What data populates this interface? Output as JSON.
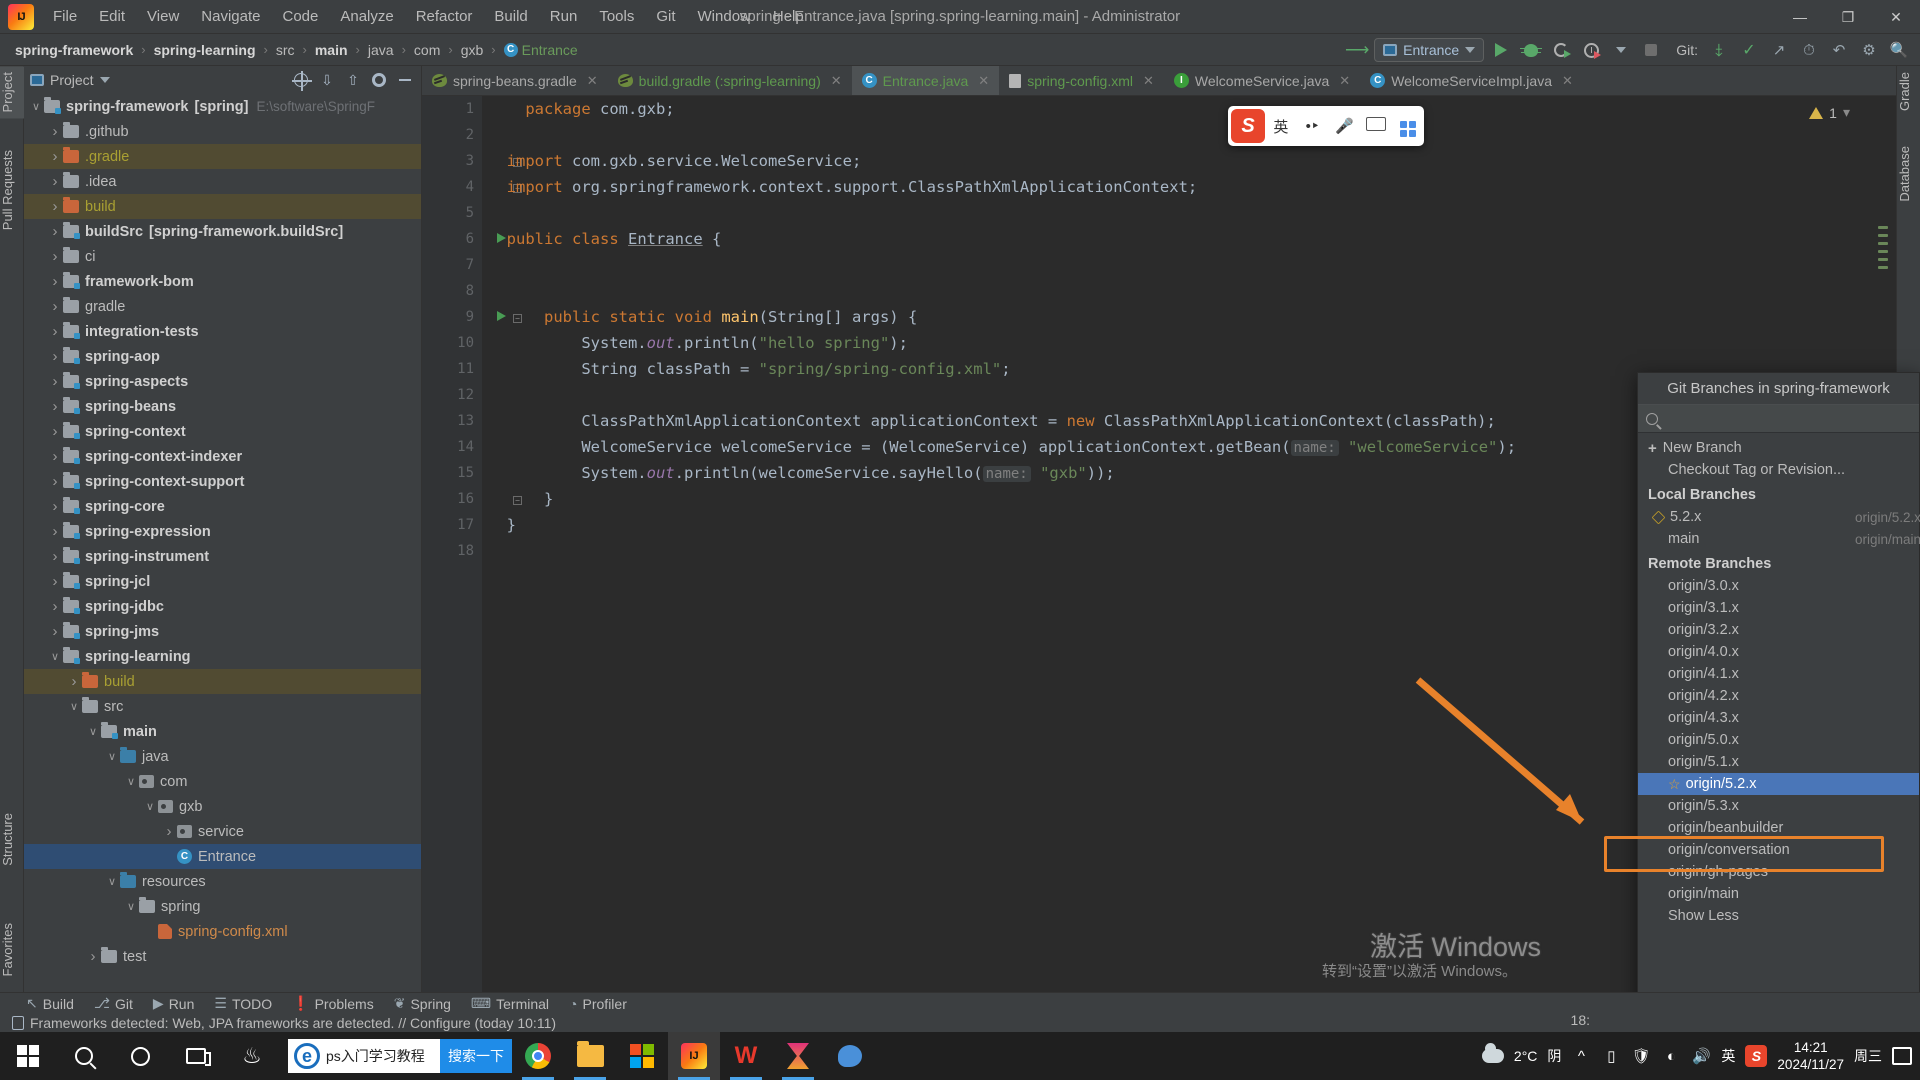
{
  "window": {
    "title": "spring - Entrance.java [spring.spring-learning.main] - Administrator",
    "minimize": "—",
    "maximize": "❐",
    "close": "✕"
  },
  "menu": {
    "items": [
      "File",
      "Edit",
      "View",
      "Navigate",
      "Code",
      "Analyze",
      "Refactor",
      "Build",
      "Run",
      "Tools",
      "Git",
      "Window",
      "Help"
    ]
  },
  "breadcrumb": {
    "items": [
      "spring-framework",
      "spring-learning",
      "src",
      "main",
      "java",
      "com",
      "gxb",
      "Entrance"
    ]
  },
  "toolbar": {
    "run_config": "Entrance",
    "git_label": "Git:",
    "icons": [
      "update-project-icon",
      "run-icon",
      "debug-icon",
      "run-coverage-icon",
      "profiler-icon",
      "stop-icon",
      "commit-icon",
      "update-icon",
      "push-icon",
      "history-icon",
      "rollback-icon",
      "settings-icon",
      "search-everywhere-icon"
    ]
  },
  "project_panel": {
    "title": "Project",
    "header_icons": [
      "locate-icon",
      "expand-all-icon",
      "collapse-all-icon",
      "gear-icon",
      "hide-icon"
    ],
    "tree": [
      {
        "depth": 0,
        "chev": "open",
        "icon": "module-folder",
        "label": "spring-framework",
        "suffix": "[spring]",
        "path": "E:\\software\\SpringF",
        "style": "bold"
      },
      {
        "depth": 1,
        "chev": "closed",
        "icon": "folder",
        "label": ".github"
      },
      {
        "depth": 1,
        "chev": "closed",
        "icon": "folder-orange",
        "label": ".gradle",
        "style": "excluded",
        "highlight": "build"
      },
      {
        "depth": 1,
        "chev": "closed",
        "icon": "folder",
        "label": ".idea"
      },
      {
        "depth": 1,
        "chev": "closed",
        "icon": "folder-orange",
        "label": "build",
        "style": "excluded",
        "highlight": "build"
      },
      {
        "depth": 1,
        "chev": "closed",
        "icon": "module-folder",
        "label": "buildSrc",
        "suffix": "[spring-framework.buildSrc]",
        "style": "bold"
      },
      {
        "depth": 1,
        "chev": "closed",
        "icon": "folder",
        "label": "ci"
      },
      {
        "depth": 1,
        "chev": "closed",
        "icon": "module-folder",
        "label": "framework-bom",
        "style": "bold"
      },
      {
        "depth": 1,
        "chev": "closed",
        "icon": "folder",
        "label": "gradle"
      },
      {
        "depth": 1,
        "chev": "closed",
        "icon": "module-folder",
        "label": "integration-tests",
        "style": "bold"
      },
      {
        "depth": 1,
        "chev": "closed",
        "icon": "module-folder",
        "label": "spring-aop",
        "style": "bold"
      },
      {
        "depth": 1,
        "chev": "closed",
        "icon": "module-folder",
        "label": "spring-aspects",
        "style": "bold"
      },
      {
        "depth": 1,
        "chev": "closed",
        "icon": "module-folder",
        "label": "spring-beans",
        "style": "bold"
      },
      {
        "depth": 1,
        "chev": "closed",
        "icon": "module-folder",
        "label": "spring-context",
        "style": "bold"
      },
      {
        "depth": 1,
        "chev": "closed",
        "icon": "module-folder",
        "label": "spring-context-indexer",
        "style": "bold"
      },
      {
        "depth": 1,
        "chev": "closed",
        "icon": "module-folder",
        "label": "spring-context-support",
        "style": "bold"
      },
      {
        "depth": 1,
        "chev": "closed",
        "icon": "module-folder",
        "label": "spring-core",
        "style": "bold"
      },
      {
        "depth": 1,
        "chev": "closed",
        "icon": "module-folder",
        "label": "spring-expression",
        "style": "bold"
      },
      {
        "depth": 1,
        "chev": "closed",
        "icon": "module-folder",
        "label": "spring-instrument",
        "style": "bold"
      },
      {
        "depth": 1,
        "chev": "closed",
        "icon": "module-folder",
        "label": "spring-jcl",
        "style": "bold"
      },
      {
        "depth": 1,
        "chev": "closed",
        "icon": "module-folder",
        "label": "spring-jdbc",
        "style": "bold"
      },
      {
        "depth": 1,
        "chev": "closed",
        "icon": "module-folder",
        "label": "spring-jms",
        "style": "bold"
      },
      {
        "depth": 1,
        "chev": "open",
        "icon": "module-folder",
        "label": "spring-learning",
        "style": "bold"
      },
      {
        "depth": 2,
        "chev": "closed",
        "icon": "folder-orange",
        "label": "build",
        "style": "excluded",
        "highlight": "build"
      },
      {
        "depth": 2,
        "chev": "open",
        "icon": "folder",
        "label": "src"
      },
      {
        "depth": 3,
        "chev": "open",
        "icon": "module-folder",
        "label": "main",
        "style": "bold"
      },
      {
        "depth": 4,
        "chev": "open",
        "icon": "folder-blue",
        "label": "java"
      },
      {
        "depth": 5,
        "chev": "open",
        "icon": "package",
        "label": "com"
      },
      {
        "depth": 6,
        "chev": "open",
        "icon": "package",
        "label": "gxb"
      },
      {
        "depth": 7,
        "chev": "closed",
        "icon": "package",
        "label": "service"
      },
      {
        "depth": 7,
        "chev": "none",
        "icon": "class",
        "label": "Entrance",
        "selected": true
      },
      {
        "depth": 4,
        "chev": "open",
        "icon": "folder-blue",
        "label": "resources"
      },
      {
        "depth": 5,
        "chev": "open",
        "icon": "folder",
        "label": "spring"
      },
      {
        "depth": 6,
        "chev": "none",
        "icon": "xml",
        "label": "spring-config.xml",
        "style": "xml"
      },
      {
        "depth": 3,
        "chev": "closed",
        "icon": "folder",
        "label": "test"
      }
    ]
  },
  "left_stripe": {
    "tabs": [
      "Project",
      "Pull Requests",
      "Structure",
      "Favorites"
    ]
  },
  "right_stripe": {
    "tabs": [
      "Gradle",
      "Database"
    ]
  },
  "editor": {
    "tabs": [
      {
        "label": "spring-beans.gradle",
        "icon": "gradle-icon",
        "active": false,
        "color": "normal"
      },
      {
        "label": "build.gradle (:spring-learning)",
        "icon": "gradle-icon",
        "active": false,
        "color": "green"
      },
      {
        "label": "Entrance.java",
        "icon": "class-icon",
        "active": true,
        "color": "green"
      },
      {
        "label": "spring-config.xml",
        "icon": "xml-icon",
        "active": false,
        "color": "green"
      },
      {
        "label": "WelcomeService.java",
        "icon": "interface-icon",
        "active": false,
        "color": "normal"
      },
      {
        "label": "WelcomeServiceImpl.java",
        "icon": "class-icon",
        "active": false,
        "color": "normal"
      }
    ],
    "warning_count": "1",
    "lines": [
      {
        "n": "1",
        "html": "    <span class='kw'>package</span> com.gxb;"
      },
      {
        "n": "2",
        "html": ""
      },
      {
        "n": "3",
        "html": "  <span class='kw'>import</span> com.gxb.service.WelcomeService;",
        "fold": true
      },
      {
        "n": "4",
        "html": "  <span class='kw'>import</span> org.springframework.context.support.ClassPathXmlApplicationContext;",
        "fold": true
      },
      {
        "n": "5",
        "html": ""
      },
      {
        "n": "6",
        "html": "  <span class='kw'>public class</span> <span class='sq-under'>Entrance</span> {",
        "run": true
      },
      {
        "n": "7",
        "html": ""
      },
      {
        "n": "8",
        "html": ""
      },
      {
        "n": "9",
        "html": "      <span class='kw'>public static void</span> <span class='mth'>main</span>(String[] args) {",
        "run": true,
        "fold": true
      },
      {
        "n": "10",
        "html": "          System.<span class='fld'>out</span>.println(<span class='str'>\"hello spring\"</span>);"
      },
      {
        "n": "11",
        "html": "          String classPath = <span class='str'>\"spring/spring-config.xml\"</span>;"
      },
      {
        "n": "12",
        "html": ""
      },
      {
        "n": "13",
        "html": "          ClassPathXmlApplicationContext applicationContext = <span class='kw'>new</span> ClassPathXmlApplicationContext(classPath);"
      },
      {
        "n": "14",
        "html": "          WelcomeService welcomeService = (WelcomeService) applicationContext.getBean(<span class='param-hint'>name:</span> <span class='str'>\"welcomeService\"</span>);"
      },
      {
        "n": "15",
        "html": "          System.<span class='fld'>out</span>.println(welcomeService.sayHello(<span class='param-hint'>name:</span> <span class='str'>\"gxb\"</span>));"
      },
      {
        "n": "16",
        "html": "      }",
        "fold": true
      },
      {
        "n": "17",
        "html": "  }"
      },
      {
        "n": "18",
        "html": ""
      }
    ]
  },
  "ime_bar": {
    "logo": "sogou-icon",
    "mode": "英",
    "items": [
      "voice-icon",
      "keyboard-icon",
      "toolbox-icon"
    ]
  },
  "git_popup": {
    "title": "Git Branches in spring-framework",
    "search_placeholder": "",
    "new_branch": "New Branch",
    "checkout": "Checkout Tag or Revision...",
    "local_header": "Local Branches",
    "local": [
      {
        "name": "5.2.x",
        "tracking": "origin/5.2.x",
        "current": true
      },
      {
        "name": "main",
        "tracking": "origin/main",
        "current": false
      }
    ],
    "remote_header": "Remote Branches",
    "remote": [
      {
        "name": "origin/3.0.x"
      },
      {
        "name": "origin/3.1.x"
      },
      {
        "name": "origin/3.2.x"
      },
      {
        "name": "origin/4.0.x"
      },
      {
        "name": "origin/4.1.x"
      },
      {
        "name": "origin/4.2.x"
      },
      {
        "name": "origin/4.3.x"
      },
      {
        "name": "origin/5.0.x"
      },
      {
        "name": "origin/5.1.x"
      },
      {
        "name": "origin/5.2.x",
        "selected": true,
        "favorite": true
      },
      {
        "name": "origin/5.3.x"
      },
      {
        "name": "origin/beanbuilder"
      },
      {
        "name": "origin/conversation"
      },
      {
        "name": "origin/gh-pages"
      },
      {
        "name": "origin/main"
      }
    ],
    "show_less": "Show Less"
  },
  "annotation": {
    "color": "#e8822b"
  },
  "watermark": {
    "line1": "激活 Windows",
    "line2": "转到“设置”以激活 Windows。"
  },
  "bottom_bar": {
    "tools": [
      {
        "label": "Build",
        "icon": "build-icon"
      },
      {
        "label": "Git",
        "icon": "git-icon"
      },
      {
        "label": "Run",
        "icon": "run-icon"
      },
      {
        "label": "TODO",
        "icon": "todo-icon"
      },
      {
        "label": "Problems",
        "icon": "problems-icon"
      },
      {
        "label": "Spring",
        "icon": "spring-icon"
      },
      {
        "label": "Terminal",
        "icon": "terminal-icon"
      },
      {
        "label": "Profiler",
        "icon": "profiler-icon"
      }
    ],
    "status": "Frameworks detected: Web, JPA frameworks are detected. // Configure (today 10:11)",
    "caret": "18:"
  },
  "taskbar": {
    "search_text": "ps入门学习教程",
    "search_button": "搜索一下",
    "apps": [
      "chrome-icon",
      "explorer-icon",
      "microsoft-store-icon",
      "intellij-icon",
      "wps-icon",
      "hourglass-icon",
      "tencent-icon"
    ],
    "tray": {
      "weather_temp": "2°C",
      "weather_desc": "阴",
      "ime": "英",
      "time": "14:21",
      "date": "2024/11/27",
      "week": "周三"
    }
  }
}
